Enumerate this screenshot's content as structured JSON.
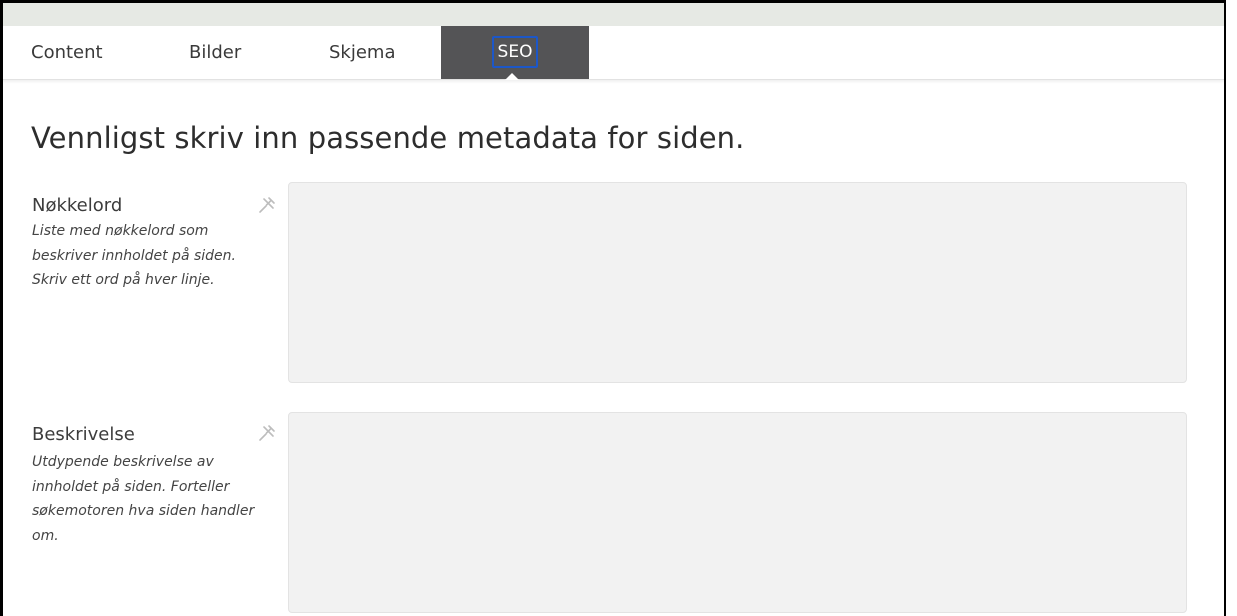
{
  "tabs": [
    {
      "label": "Content",
      "active": false
    },
    {
      "label": "Bilder",
      "active": false
    },
    {
      "label": "Skjema",
      "active": false
    },
    {
      "label": "SEO",
      "active": true
    }
  ],
  "colors": {
    "active_tab_bg": "#545456",
    "focus_outline": "#1c57c8",
    "field_bg": "#f2f2f2"
  },
  "page": {
    "heading": "Vennligst skriv inn passende metadata for siden."
  },
  "fields": {
    "keywords": {
      "label": "Nøkkelord",
      "help": "Liste med nøkkelord som beskriver innholdet på siden. Skriv ett ord på hver linje.",
      "value": "",
      "icon": "pin-icon"
    },
    "description": {
      "label": "Beskrivelse",
      "help": "Utdypende beskrivelse av innholdet på siden. Forteller søkemotoren hva siden handler om.",
      "value": "",
      "icon": "pin-icon"
    }
  }
}
